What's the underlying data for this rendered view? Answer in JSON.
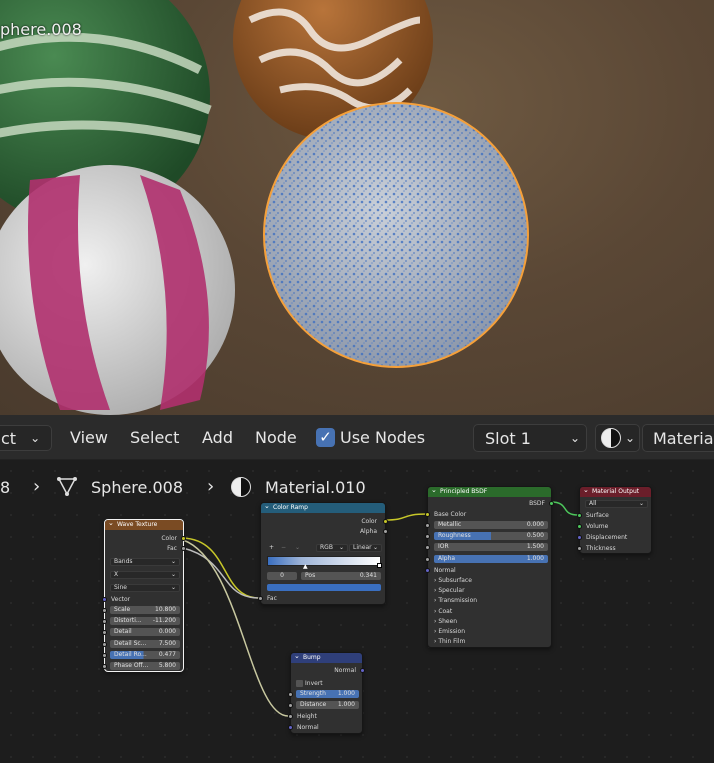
{
  "viewport": {
    "object_label": "phere.008"
  },
  "header": {
    "mode_label": "ct",
    "menu": [
      "View",
      "Select",
      "Add",
      "Node"
    ],
    "use_nodes_label": "Use Nodes",
    "slot_label": "Slot 1",
    "material_label": "Material"
  },
  "breadcrumb": {
    "first": "8",
    "object": "Sphere.008",
    "material": "Material.010"
  },
  "nodes": {
    "wave": {
      "title": "Wave Texture",
      "out_color": "Color",
      "out_fac": "Fac",
      "type": "Bands",
      "dir": "X",
      "profile": "Sine",
      "vector": "Vector",
      "fields": [
        {
          "label": "Scale",
          "value": "10.800"
        },
        {
          "label": "Distorti...",
          "value": "-11.200"
        },
        {
          "label": "Detail",
          "value": "0.000"
        },
        {
          "label": "Detail Sc...",
          "value": "7.500"
        },
        {
          "label": "Detail Ro...",
          "value": "0.477"
        },
        {
          "label": "Phase Off...",
          "value": "5.800"
        }
      ]
    },
    "ramp": {
      "title": "Color Ramp",
      "out_color": "Color",
      "out_alpha": "Alpha",
      "mode": "RGB",
      "interp": "Linear",
      "index": "0",
      "pos_label": "Pos",
      "pos_value": "0.341",
      "in_fac": "Fac",
      "btn_plus": "+",
      "btn_minus": "−",
      "btn_more": "⌄"
    },
    "bsdf": {
      "title": "Principled BSDF",
      "out": "BSDF",
      "base_color": "Base Color",
      "fields": [
        {
          "label": "Metallic",
          "value": "0.000",
          "fill": 0
        },
        {
          "label": "Roughness",
          "value": "0.500",
          "fill": 0.5
        },
        {
          "label": "IOR",
          "value": "1.500",
          "fill": 0
        },
        {
          "label": "Alpha",
          "value": "1.000",
          "fill": 1
        }
      ],
      "normal": "Normal",
      "panels": [
        "Subsurface",
        "Specular",
        "Transmission",
        "Coat",
        "Sheen",
        "Emission",
        "Thin Film"
      ]
    },
    "output": {
      "title": "Material Output",
      "target": "All",
      "inputs": [
        "Surface",
        "Volume",
        "Displacement",
        "Thickness"
      ]
    },
    "bump": {
      "title": "Bump",
      "out": "Normal",
      "invert": "Invert",
      "strength_label": "Strength",
      "strength": "1.000",
      "distance_label": "Distance",
      "distance": "1.000",
      "in_height": "Height",
      "in_normal": "Normal"
    }
  },
  "colors": {
    "accent": "#4772b3",
    "selection": "#f5a03a",
    "wave_header": "#7a4b23",
    "ramp_header": "#245d7a",
    "bsdf_header": "#2b6b2b",
    "output_header": "#6b1e2a",
    "bump_header": "#2f3f7a"
  }
}
